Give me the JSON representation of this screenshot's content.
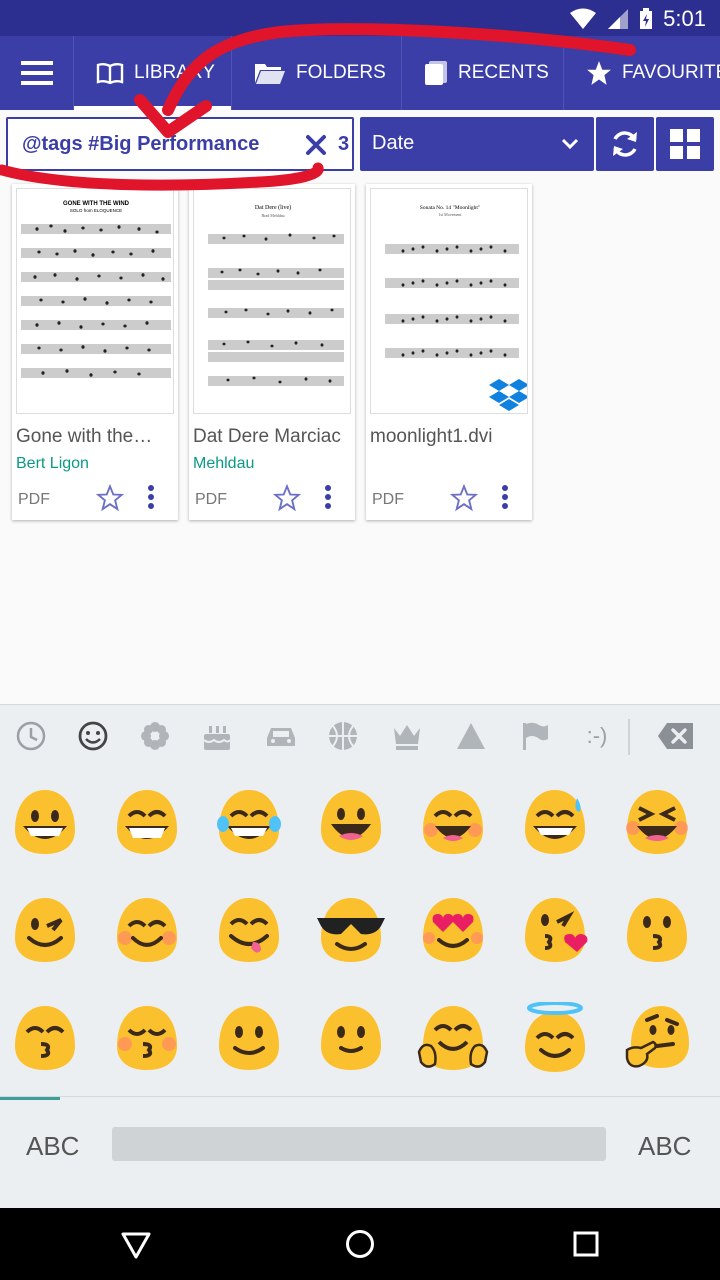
{
  "status_bar": {
    "time": "5:01"
  },
  "nav": {
    "tabs": [
      {
        "label": "LIBRARY",
        "icon": "book-icon",
        "active": true
      },
      {
        "label": "FOLDERS",
        "icon": "folder-icon"
      },
      {
        "label": "RECENTS",
        "icon": "recents-icon"
      },
      {
        "label": "FAVOURITES",
        "icon": "star-icon"
      }
    ]
  },
  "filter": {
    "search_value": "@tags #Big Performance",
    "result_count": "3",
    "sort_label": "Date"
  },
  "cards": [
    {
      "title": "Gone with the…",
      "composer": "Bert Ligon",
      "type": "PDF",
      "sheet_title": "GONE WITH THE WIND",
      "sheet_sub": "SOLO from ELOQUENCE",
      "cloud": false
    },
    {
      "title": "Dat Dere Marciac",
      "composer": "Mehldau",
      "type": "PDF",
      "sheet_title": "Dat Dere (live)",
      "sheet_sub": "Brad Mehldau",
      "cloud": false
    },
    {
      "title": "moonlight1.dvi",
      "composer": "",
      "type": "PDF",
      "sheet_title": "Sonata No. 14 \"Moonlight\"",
      "sheet_sub": "1st Movement",
      "cloud": true
    }
  ],
  "keyboard": {
    "categories": [
      "recent-icon",
      "smiley-icon",
      "flower-icon",
      "cake-icon",
      "car-icon",
      "ball-icon",
      "crown-icon",
      "triangle-icon",
      "flag-icon",
      "emoticon-text"
    ],
    "emoticon_text": ":-)",
    "abc_left": "ABC",
    "abc_right": "ABC",
    "emojis": [
      "grinning",
      "grin",
      "joy-tears",
      "open-smile",
      "smile-blush",
      "sweat-smile",
      "laughing",
      "wink",
      "blush",
      "yum",
      "sunglasses",
      "heart-eyes",
      "kiss-heart",
      "kissing",
      "kissing-smiling",
      "kissing-closed",
      "slight-smile",
      "slight-smile-2",
      "hugging",
      "innocent",
      "thinking"
    ]
  },
  "colors": {
    "primary": "#3a3ea6",
    "statusbar": "#2c2f8f",
    "teal": "#0a9a86",
    "annotation": "#e0142a",
    "emoji": "#fbc02d"
  }
}
